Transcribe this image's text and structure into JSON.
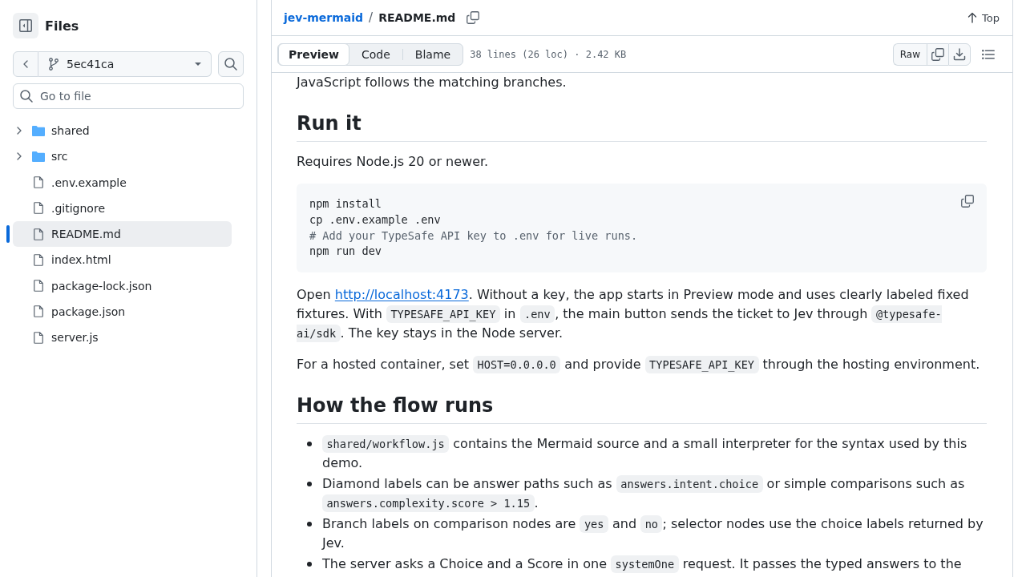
{
  "sidebar": {
    "title": "Files",
    "branch": "5ec41ca",
    "search": {
      "placeholder": "Go to file"
    },
    "tree": [
      {
        "name": "shared",
        "kind": "folder",
        "expanded": false,
        "selected": false
      },
      {
        "name": "src",
        "kind": "folder",
        "expanded": false,
        "selected": false
      },
      {
        "name": ".env.example",
        "kind": "file",
        "selected": false
      },
      {
        "name": ".gitignore",
        "kind": "file",
        "selected": false
      },
      {
        "name": "README.md",
        "kind": "file",
        "selected": true
      },
      {
        "name": "index.html",
        "kind": "file",
        "selected": false
      },
      {
        "name": "package-lock.json",
        "kind": "file",
        "selected": false
      },
      {
        "name": "package.json",
        "kind": "file",
        "selected": false
      },
      {
        "name": "server.js",
        "kind": "file",
        "selected": false
      }
    ]
  },
  "header": {
    "breadcrumb": [
      {
        "kind": "link",
        "text": "jev-mermaid"
      },
      {
        "kind": "separator",
        "text": "/"
      },
      {
        "kind": "current",
        "text": "README.md"
      }
    ],
    "top_link": "Top"
  },
  "toolbar": {
    "tabs": [
      {
        "label": "Preview",
        "selected": true
      },
      {
        "label": "Code",
        "selected": false
      },
      {
        "label": "Blame",
        "selected": false
      }
    ],
    "file_info": "38 lines (26 loc) · 2.42 KB",
    "raw_button": "Raw"
  },
  "readme": [
    {
      "kind": "paragraph",
      "parts": [
        {
          "kind": "text",
          "text": "JavaScript follows the matching branches."
        }
      ]
    },
    {
      "kind": "heading",
      "text": "Run it"
    },
    {
      "kind": "paragraph",
      "parts": [
        {
          "kind": "text",
          "text": "Requires Node.js 20 or newer."
        }
      ]
    },
    {
      "kind": "code",
      "lines": [
        {
          "kind": "command",
          "text": "npm install"
        },
        {
          "kind": "command",
          "text": "cp .env.example .env"
        },
        {
          "kind": "comment",
          "text": "# Add your TypeSafe API key to .env for live runs."
        },
        {
          "kind": "command",
          "text": "npm run dev"
        }
      ]
    },
    {
      "kind": "paragraph",
      "parts": [
        {
          "kind": "text",
          "text": "Open "
        },
        {
          "kind": "link",
          "text": "http://localhost:4173"
        },
        {
          "kind": "text",
          "text": ". Without a key, the app starts in Preview mode and uses clearly labeled fixed fixtures. With "
        },
        {
          "kind": "code",
          "text": "TYPESAFE_API_KEY"
        },
        {
          "kind": "text",
          "text": " in "
        },
        {
          "kind": "code",
          "text": ".env"
        },
        {
          "kind": "text",
          "text": ", the main button sends the ticket to Jev through "
        },
        {
          "kind": "code",
          "text": "@typesafe-ai/sdk"
        },
        {
          "kind": "text",
          "text": ". The key stays in the Node server."
        }
      ]
    },
    {
      "kind": "paragraph",
      "parts": [
        {
          "kind": "text",
          "text": "For a hosted container, set "
        },
        {
          "kind": "code",
          "text": "HOST=0.0.0.0"
        },
        {
          "kind": "text",
          "text": " and provide "
        },
        {
          "kind": "code",
          "text": "TYPESAFE_API_KEY"
        },
        {
          "kind": "text",
          "text": " through the hosting environment."
        }
      ]
    },
    {
      "kind": "heading",
      "text": "How the flow runs"
    },
    {
      "kind": "list",
      "items": [
        {
          "parts": [
            {
              "kind": "code",
              "text": "shared/workflow.js"
            },
            {
              "kind": "text",
              "text": " contains the Mermaid source and a small interpreter for the syntax used by this demo."
            }
          ]
        },
        {
          "parts": [
            {
              "kind": "text",
              "text": "Diamond labels can be answer paths such as "
            },
            {
              "kind": "code",
              "text": "answers.intent.choice"
            },
            {
              "kind": "text",
              "text": " or simple comparisons such as "
            },
            {
              "kind": "code",
              "text": "answers.complexity.score > 1.15"
            },
            {
              "kind": "text",
              "text": "."
            }
          ]
        },
        {
          "parts": [
            {
              "kind": "text",
              "text": "Branch labels on comparison nodes are "
            },
            {
              "kind": "code",
              "text": "yes"
            },
            {
              "kind": "text",
              "text": " and "
            },
            {
              "kind": "code",
              "text": "no"
            },
            {
              "kind": "text",
              "text": "; selector nodes use the choice labels returned by Jev."
            }
          ]
        },
        {
          "parts": [
            {
              "kind": "text",
              "text": "The server asks a Choice and a Score in one "
            },
            {
              "kind": "code",
              "text": "systemOne"
            },
            {
              "kind": "text",
              "text": " request. It passes the typed answers to the"
            }
          ]
        }
      ]
    }
  ]
}
